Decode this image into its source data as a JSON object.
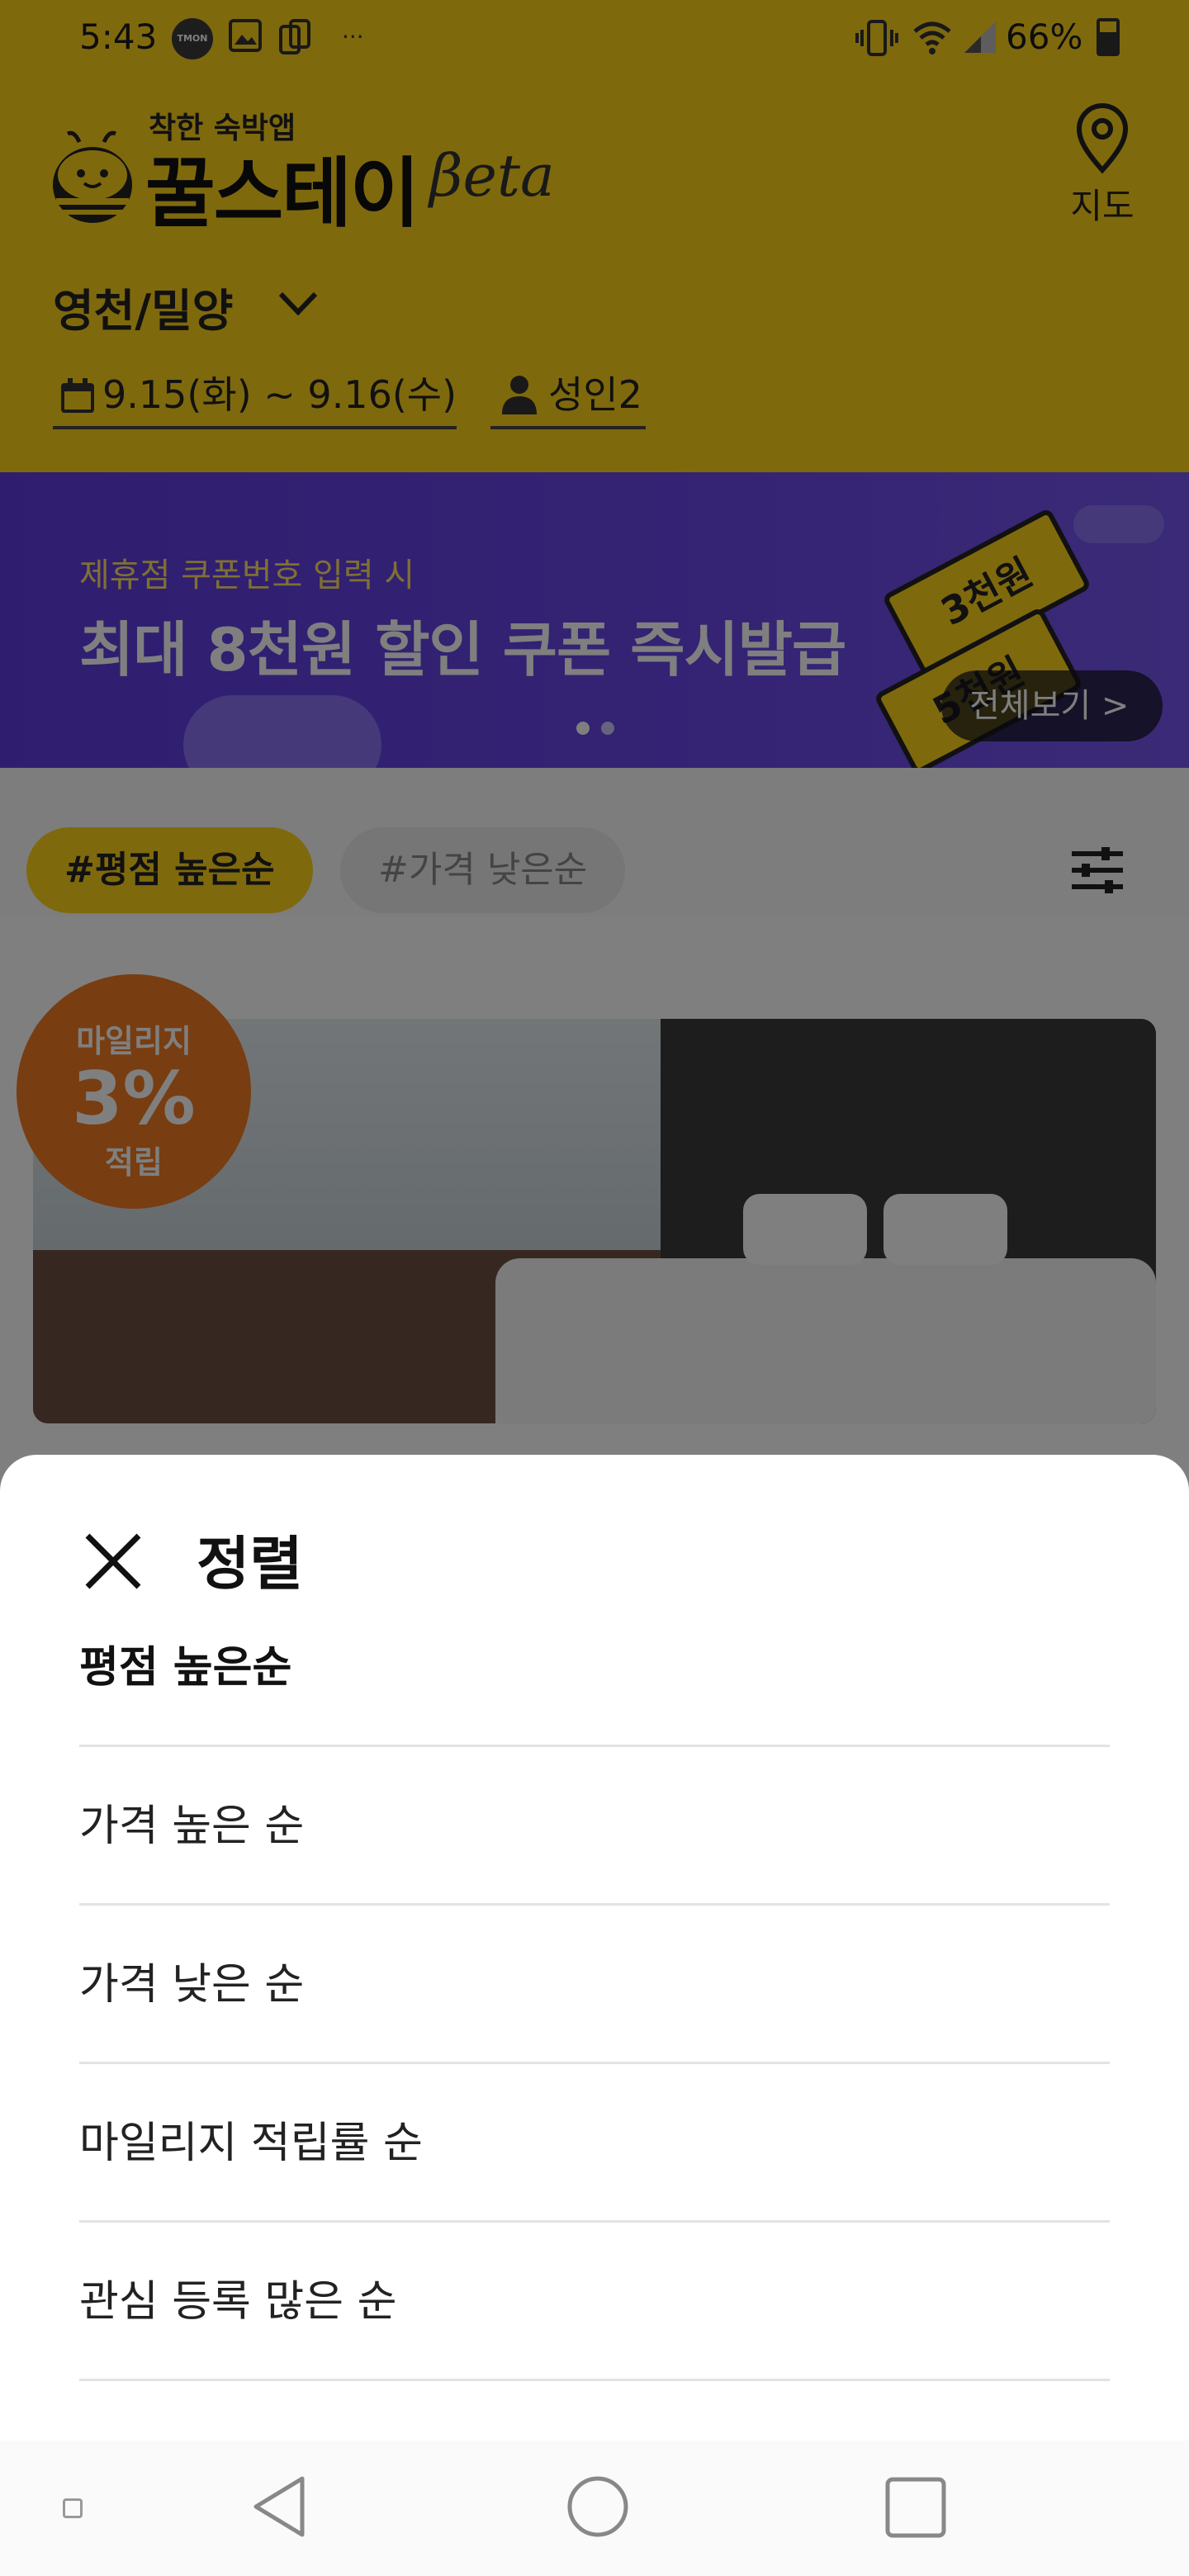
{
  "status_bar": {
    "time": "5:43",
    "notification_badge": "TMON",
    "overflow": "···",
    "battery": "66%"
  },
  "header": {
    "tagline": "착한 숙박앱",
    "app_name": "꿀스테이",
    "beta_label": "βeta",
    "map_label": "지도",
    "region": "영천/밀양",
    "dates": "9.15(화) ~ 9.16(수)",
    "guests": "성인2"
  },
  "banner": {
    "subtitle": "제휴점 쿠폰번호 입력 시",
    "headline": "최대 8천원 할인 쿠폰  즉시발급",
    "ticket_1": "3천원",
    "ticket_2": "5천원",
    "see_all": "전체보기 >"
  },
  "sort_chips": {
    "active": "#평점 높은순",
    "inactive": "#가격 낮은순"
  },
  "listing": {
    "mileage_top": "마일리지",
    "mileage_value": "3%",
    "mileage_bottom": "적립"
  },
  "sheet": {
    "title": "정렬",
    "options": [
      {
        "label": "평점 높은순",
        "selected": true
      },
      {
        "label": "가격 높은 순",
        "selected": false
      },
      {
        "label": "가격 낮은 순",
        "selected": false
      },
      {
        "label": "마일리지 적립률 순",
        "selected": false
      },
      {
        "label": "관심 등록 많은 순",
        "selected": false
      }
    ]
  },
  "colors": {
    "brand_yellow": "#FFD21A",
    "banner_purple": "#6A46E8",
    "mileage_orange": "#F07A22"
  },
  "icons": [
    "map-pin-icon",
    "chevron-down-icon",
    "calendar-icon",
    "person-icon",
    "filter-icon",
    "close-icon",
    "back-icon",
    "home-icon",
    "recent-apps-icon"
  ]
}
